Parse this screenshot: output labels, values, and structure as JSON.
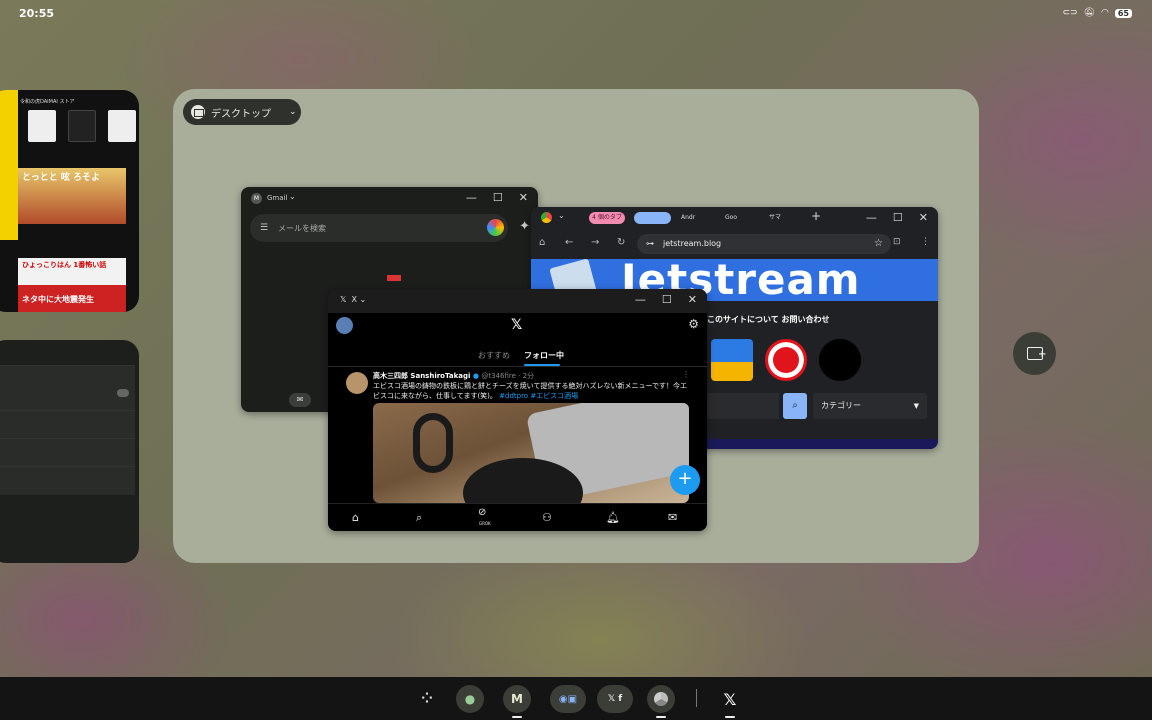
{
  "status_bar": {
    "time": "20:55",
    "battery": "65"
  },
  "left_card": {
    "store_text": "令和の虎DAIMAI ストア",
    "thumb1_text": "とっとと 呟 ろそよ",
    "thumb2_text": "ひょっこりはん 1番怖い話",
    "thumb3_text": "ネタ中に大地震発生"
  },
  "desktop": {
    "label": "デスクトップ"
  },
  "gmail": {
    "app_name": "Gmail",
    "search_placeholder": "メールを検索"
  },
  "chrome": {
    "tab_group": "4 個のタブ",
    "tabs": [
      "Andr",
      "Goo",
      "サマ"
    ],
    "url": "jetstream.blog",
    "banner_title": "Jetstream",
    "menu_text": "このサイトについて  お問い合わせ",
    "category_label": "カテゴリー"
  },
  "x_window": {
    "app_name": "X",
    "tab_recommended": "おすすめ",
    "tab_following": "フォロー中",
    "post_author": "高木三四郎 SanshiroTakagi",
    "post_handle": "@t346fire · 2分",
    "post_text": "エビスコ酒場の鋳物の鉄板に鶏と餅とチーズを焼いて提供する絶対ハズレない新メニューです！今エビスコに来ながら、仕事してます(笑)。",
    "post_tags": "#ddtpro #エビスコ酒場",
    "grok_label": "GROK"
  },
  "icons": {
    "close": "close-icon",
    "maximize": "maximize-icon",
    "minimize": "minimize-icon"
  }
}
